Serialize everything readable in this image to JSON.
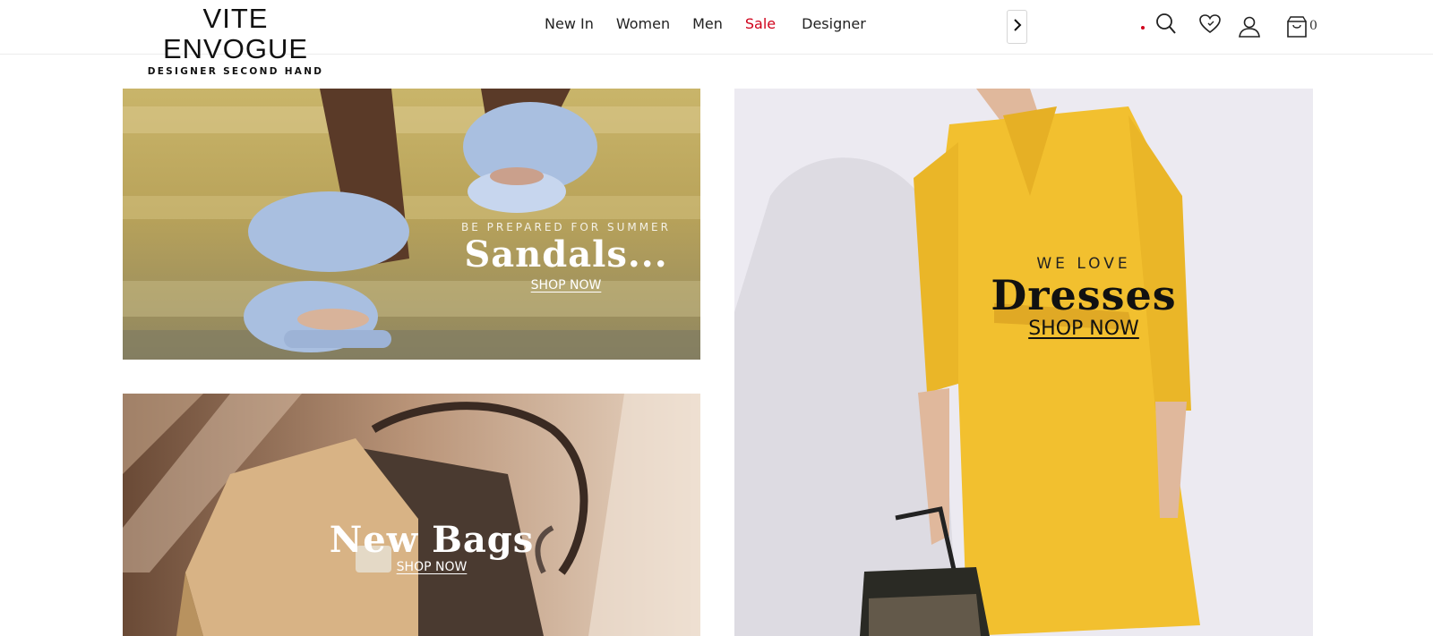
{
  "brand": {
    "name": "VITE ENVOGUE",
    "tagline": "DESIGNER SECOND HAND"
  },
  "nav": {
    "items": [
      {
        "label": "New In"
      },
      {
        "label": "Women"
      },
      {
        "label": "Men"
      },
      {
        "label": "Sale"
      },
      {
        "label": "Designer"
      }
    ],
    "scroll_icon": "chevron-right-icon"
  },
  "header_icons": {
    "search": "search-icon",
    "wishlist": "heart-icon",
    "account": "user-icon",
    "cart": "shopping-bag-icon",
    "cart_count": "0"
  },
  "colors": {
    "sale": "#d0021b",
    "text": "#222222"
  },
  "banners": {
    "sandals": {
      "kicker": "BE PREPARED FOR SUMMER",
      "headline": "Sandals...",
      "cta": "SHOP NOW"
    },
    "dresses": {
      "kicker": "WE LOVE",
      "headline": "Dresses",
      "cta": "SHOP NOW"
    },
    "bags": {
      "headline": "New Bags",
      "cta": "SHOP NOW"
    }
  }
}
